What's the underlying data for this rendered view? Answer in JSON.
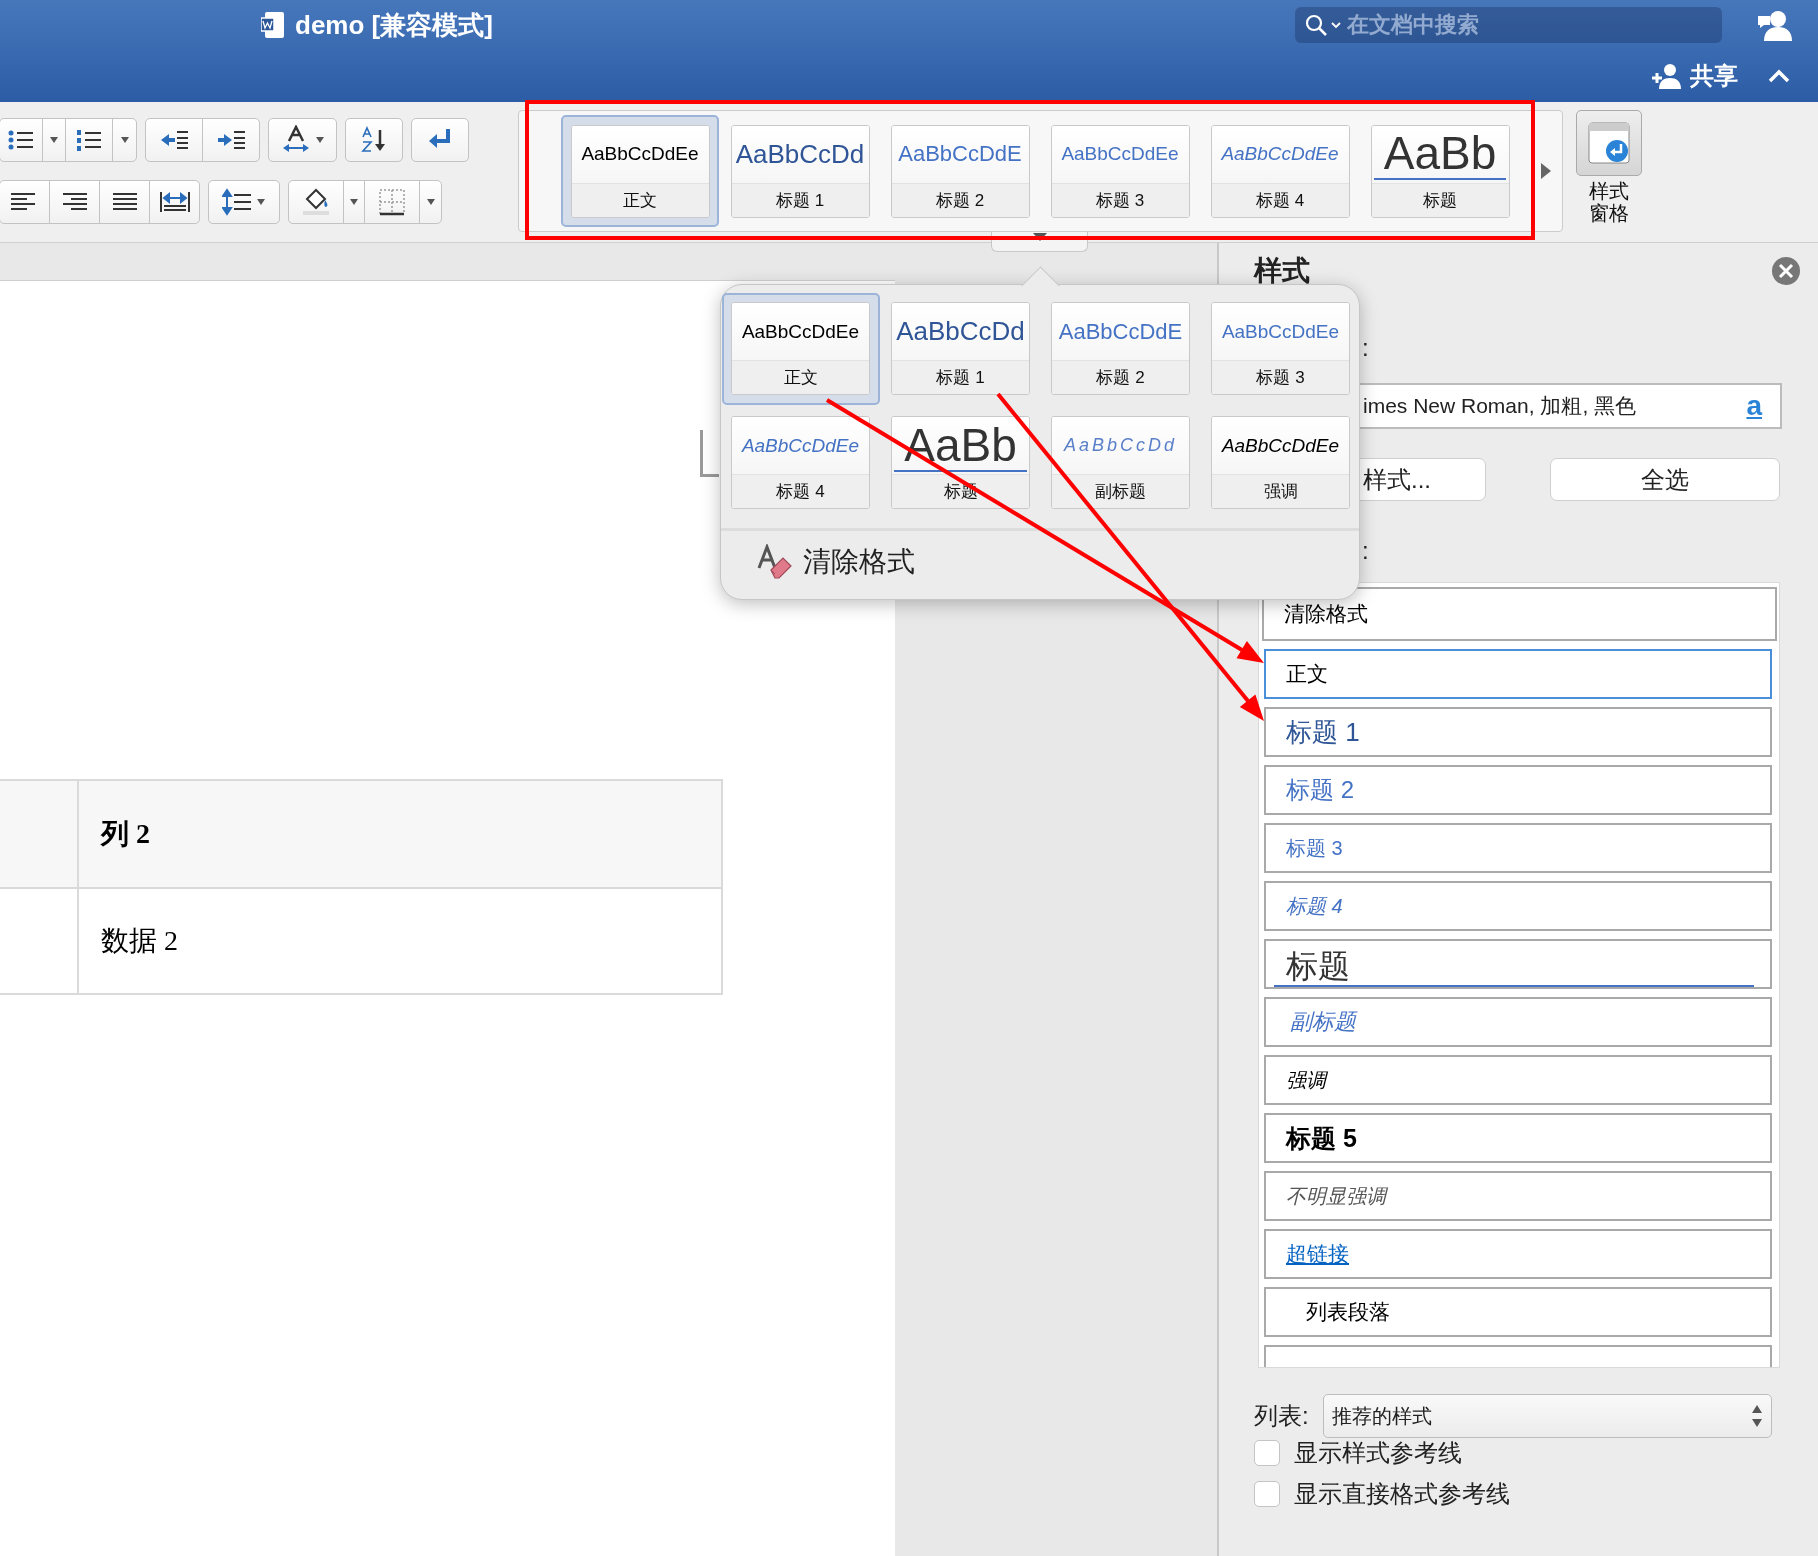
{
  "window": {
    "title": "demo [兼容模式]",
    "search": {
      "placeholder": "在文档中搜索"
    },
    "share": "共享"
  },
  "ribbon": {
    "gallery": [
      {
        "kind": "normal",
        "sample": "AaBbCcDdEe",
        "label": "正文",
        "selected": true
      },
      {
        "kind": "heading1",
        "sample": "AaBbCcDd",
        "label": "标题 1",
        "selected": false
      },
      {
        "kind": "heading2",
        "sample": "AaBbCcDdE",
        "label": "标题 2",
        "selected": false
      },
      {
        "kind": "heading3",
        "sample": "AaBbCcDdEe",
        "label": "标题 3",
        "selected": false
      },
      {
        "kind": "heading4",
        "sample": "AaBbCcDdEe",
        "label": "标题 4",
        "selected": false
      },
      {
        "kind": "title",
        "sample": "AaBb",
        "label": "标题",
        "selected": false
      }
    ],
    "styles_pane_button": "样式窗格"
  },
  "popup": {
    "styles": [
      {
        "kind": "normal",
        "sample": "AaBbCcDdEe",
        "label": "正文",
        "selected": true
      },
      {
        "kind": "heading1",
        "sample": "AaBbCcDd",
        "label": "标题 1",
        "selected": false
      },
      {
        "kind": "heading2",
        "sample": "AaBbCcDdE",
        "label": "标题 2",
        "selected": false
      },
      {
        "kind": "heading3",
        "sample": "AaBbCcDdEe",
        "label": "标题 3",
        "selected": false
      },
      {
        "kind": "heading4",
        "sample": "AaBbCcDdEe",
        "label": "标题 4",
        "selected": false
      },
      {
        "kind": "title",
        "sample": "AaBb",
        "label": "标题",
        "selected": false
      },
      {
        "kind": "subtitle",
        "sample": "AaBbCcDd",
        "label": "副标题",
        "selected": false
      },
      {
        "kind": "emphasis",
        "sample": "AaBbCcDdEe",
        "label": "强调",
        "selected": false
      }
    ],
    "clear_formatting": "清除格式"
  },
  "document": {
    "table": {
      "rows": [
        {
          "kind": "header",
          "column_2": "列 2"
        },
        {
          "kind": "data",
          "column_2": "数据 2"
        }
      ]
    }
  },
  "styles_pane": {
    "title": "样式",
    "current_style_label": ":",
    "description": "imes New Roman, 加粗, 黑色",
    "inspector": "a",
    "buttons": [
      "样式...",
      "全选"
    ],
    "list_label": ":",
    "styles": [
      {
        "kind": "clear",
        "label": "清除格式",
        "selected": false
      },
      {
        "kind": "normal",
        "label": "正文",
        "selected": true
      },
      {
        "kind": "heading1",
        "label": "标题 1",
        "selected": false
      },
      {
        "kind": "heading2",
        "label": "标题 2",
        "selected": false
      },
      {
        "kind": "heading3",
        "label": "标题 3",
        "selected": false
      },
      {
        "kind": "heading4",
        "label": "标题 4",
        "selected": false
      },
      {
        "kind": "title",
        "label": "标题",
        "selected": false
      },
      {
        "kind": "subtitle",
        "label": "副标题",
        "selected": false
      },
      {
        "kind": "emphasis",
        "label": "强调",
        "selected": false
      },
      {
        "kind": "heading5",
        "label": "标题 5",
        "selected": false
      },
      {
        "kind": "subtle_emphasis",
        "label": "不明显强调",
        "selected": false
      },
      {
        "kind": "hyperlink",
        "label": "超链接",
        "selected": false
      },
      {
        "kind": "list_paragraph",
        "label": "列表段落",
        "selected": false
      }
    ],
    "more_below": true,
    "filter_label": "列表:",
    "filter_value": "推荐的样式",
    "checkboxes": [
      {
        "label": "显示样式参考线",
        "checked": false
      },
      {
        "label": "显示直接格式参考线",
        "checked": false
      }
    ]
  }
}
